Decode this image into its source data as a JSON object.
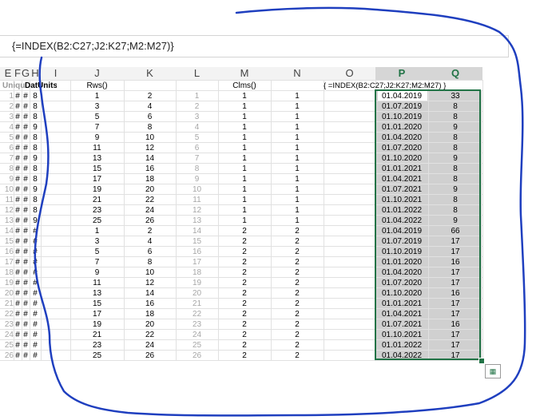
{
  "formula_bar": {
    "formula": "{=INDEX(B2:C27;J2:K27;M2:M27)}"
  },
  "columns": [
    "E",
    "F",
    "G",
    "H",
    "I",
    "J",
    "K",
    "L",
    "M",
    "N",
    "O",
    "P",
    "Q"
  ],
  "header_row": {
    "left_a": "Uniqu",
    "left_b": "Dat",
    "left_c": "Units",
    "j_label": "Rws()",
    "m_label": "Clms()",
    "o_label": "{ =INDEX(B2:C27;J2:K27;M2:M27) }"
  },
  "rows": [
    {
      "n": "1",
      "J": "1",
      "K": "2",
      "L": "1",
      "M": "1",
      "N": "1",
      "P": "01.04.2019",
      "Q": "33"
    },
    {
      "n": "2",
      "J": "3",
      "K": "4",
      "L": "2",
      "M": "1",
      "N": "1",
      "P": "01.07.2019",
      "Q": "8"
    },
    {
      "n": "3",
      "J": "5",
      "K": "6",
      "L": "3",
      "M": "1",
      "N": "1",
      "P": "01.10.2019",
      "Q": "8"
    },
    {
      "n": "4",
      "J": "7",
      "K": "8",
      "L": "4",
      "M": "1",
      "N": "1",
      "P": "01.01.2020",
      "Q": "9"
    },
    {
      "n": "5",
      "J": "9",
      "K": "10",
      "L": "5",
      "M": "1",
      "N": "1",
      "P": "01.04.2020",
      "Q": "8"
    },
    {
      "n": "6",
      "J": "11",
      "K": "12",
      "L": "6",
      "M": "1",
      "N": "1",
      "P": "01.07.2020",
      "Q": "8"
    },
    {
      "n": "7",
      "J": "13",
      "K": "14",
      "L": "7",
      "M": "1",
      "N": "1",
      "P": "01.10.2020",
      "Q": "9"
    },
    {
      "n": "8",
      "J": "15",
      "K": "16",
      "L": "8",
      "M": "1",
      "N": "1",
      "P": "01.01.2021",
      "Q": "8"
    },
    {
      "n": "9",
      "J": "17",
      "K": "18",
      "L": "9",
      "M": "1",
      "N": "1",
      "P": "01.04.2021",
      "Q": "8"
    },
    {
      "n": "10",
      "J": "19",
      "K": "20",
      "L": "10",
      "M": "1",
      "N": "1",
      "P": "01.07.2021",
      "Q": "9"
    },
    {
      "n": "11",
      "J": "21",
      "K": "22",
      "L": "11",
      "M": "1",
      "N": "1",
      "P": "01.10.2021",
      "Q": "8"
    },
    {
      "n": "12",
      "J": "23",
      "K": "24",
      "L": "12",
      "M": "1",
      "N": "1",
      "P": "01.01.2022",
      "Q": "8"
    },
    {
      "n": "13",
      "J": "25",
      "K": "26",
      "L": "13",
      "M": "1",
      "N": "1",
      "P": "01.04.2022",
      "Q": "9"
    },
    {
      "n": "14",
      "J": "1",
      "K": "2",
      "L": "14",
      "M": "2",
      "N": "2",
      "P": "01.04.2019",
      "Q": "66"
    },
    {
      "n": "15",
      "J": "3",
      "K": "4",
      "L": "15",
      "M": "2",
      "N": "2",
      "P": "01.07.2019",
      "Q": "17"
    },
    {
      "n": "16",
      "J": "5",
      "K": "6",
      "L": "16",
      "M": "2",
      "N": "2",
      "P": "01.10.2019",
      "Q": "17"
    },
    {
      "n": "17",
      "J": "7",
      "K": "8",
      "L": "17",
      "M": "2",
      "N": "2",
      "P": "01.01.2020",
      "Q": "16"
    },
    {
      "n": "18",
      "J": "9",
      "K": "10",
      "L": "18",
      "M": "2",
      "N": "2",
      "P": "01.04.2020",
      "Q": "17"
    },
    {
      "n": "19",
      "J": "11",
      "K": "12",
      "L": "19",
      "M": "2",
      "N": "2",
      "P": "01.07.2020",
      "Q": "17"
    },
    {
      "n": "20",
      "J": "13",
      "K": "14",
      "L": "20",
      "M": "2",
      "N": "2",
      "P": "01.10.2020",
      "Q": "16"
    },
    {
      "n": "21",
      "J": "15",
      "K": "16",
      "L": "21",
      "M": "2",
      "N": "2",
      "P": "01.01.2021",
      "Q": "17"
    },
    {
      "n": "22",
      "J": "17",
      "K": "18",
      "L": "22",
      "M": "2",
      "N": "2",
      "P": "01.04.2021",
      "Q": "17"
    },
    {
      "n": "23",
      "J": "19",
      "K": "20",
      "L": "23",
      "M": "2",
      "N": "2",
      "P": "01.07.2021",
      "Q": "16"
    },
    {
      "n": "24",
      "J": "21",
      "K": "22",
      "L": "24",
      "M": "2",
      "N": "2",
      "P": "01.10.2021",
      "Q": "17"
    },
    {
      "n": "25",
      "J": "23",
      "K": "24",
      "L": "25",
      "M": "2",
      "N": "2",
      "P": "01.01.2022",
      "Q": "17"
    },
    {
      "n": "26",
      "J": "25",
      "K": "26",
      "L": "26",
      "M": "2",
      "N": "2",
      "P": "01.04.2022",
      "Q": "17"
    }
  ],
  "left_digits": [
    "8",
    "8",
    "8",
    "9",
    "8",
    "8",
    "9",
    "8",
    "8",
    "9",
    "8",
    "8",
    "9"
  ],
  "hash": "#",
  "quick_analysis_icon": "quick-analysis-icon",
  "colors": {
    "selection_border": "#217346",
    "selected_header": "#217346",
    "pen": "#1f3fbf",
    "selection_fill": "#d0d0d0"
  }
}
